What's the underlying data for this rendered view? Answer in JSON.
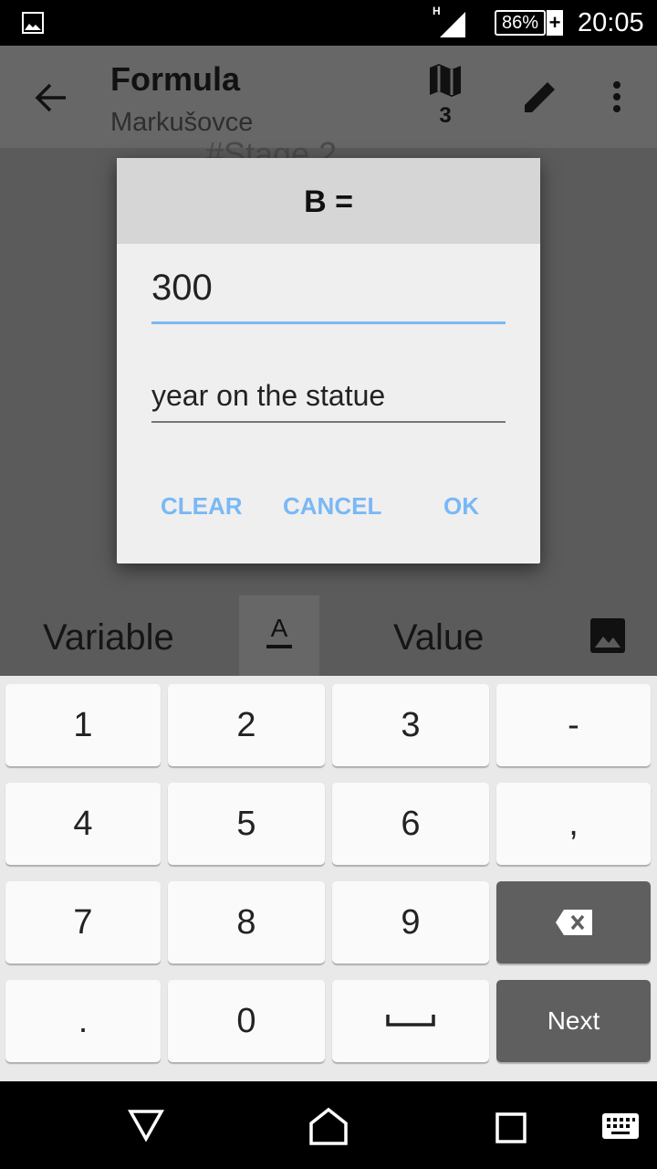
{
  "status": {
    "battery": "86%",
    "time": "20:05",
    "network": "H"
  },
  "appbar": {
    "title": "Formula",
    "subtitle": "Markušovce",
    "map_count": "3"
  },
  "background": {
    "text": "#Stage 2"
  },
  "dialog": {
    "title": "B =",
    "value": "300",
    "hint": "year on the statue",
    "buttons": {
      "clear": "CLEAR",
      "cancel": "CANCEL",
      "ok": "OK"
    },
    "accent": "#7ab8f5"
  },
  "tabs": {
    "variable": "Variable",
    "value": "Value"
  },
  "keyboard": {
    "keys": [
      "1",
      "2",
      "3",
      "-",
      "4",
      "5",
      "6",
      ",",
      "7",
      "8",
      "9",
      "",
      ".",
      "0",
      "",
      ""
    ],
    "next": "Next"
  }
}
